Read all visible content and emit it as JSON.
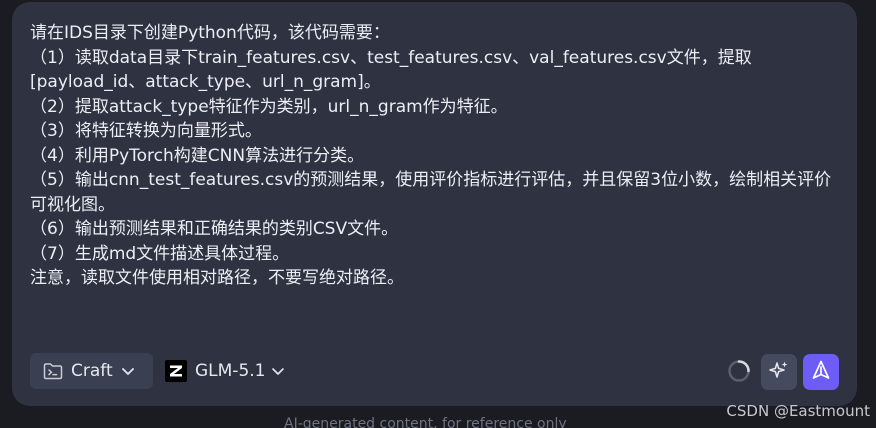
{
  "prompt": {
    "text": "请在IDS目录下创建Python代码，该代码需要：\n（1）读取data目录下train_features.csv、test_features.csv、val_features.csv文件，提取[payload_id、attack_type、url_n_gram]。\n（2）提取attack_type特征作为类别，url_n_gram作为特征。\n（3）将特征转换为向量形式。\n（4）利用PyTorch构建CNN算法进行分类。\n（5）输出cnn_test_features.csv的预测结果，使用评价指标进行评估，并且保留3位小数，绘制相关评价可视化图。\n（6）输出预测结果和正确结果的类别CSV文件。\n（7）生成md文件描述具体过程。\n注意，读取文件使用相对路径，不要写绝对路径。"
  },
  "toolbar": {
    "mode_label": "Craft",
    "mode_icon": "terminal-folder-icon",
    "model_label": "GLM-5.1",
    "model_icon": "zhipu-z-logo-icon",
    "status_icon": "loading-spinner-icon",
    "enhance_icon": "sparkle-icon",
    "send_icon": "send-arrow-icon"
  },
  "footer": {
    "note": "AI-generated content, for reference only"
  },
  "watermark": {
    "text": "CSDN @Eastmount"
  },
  "colors": {
    "background": "#1a1c22",
    "panel": "#2e3241",
    "text": "#eceef3",
    "accent": "#6e5cf6",
    "button": "#3a3f51"
  }
}
